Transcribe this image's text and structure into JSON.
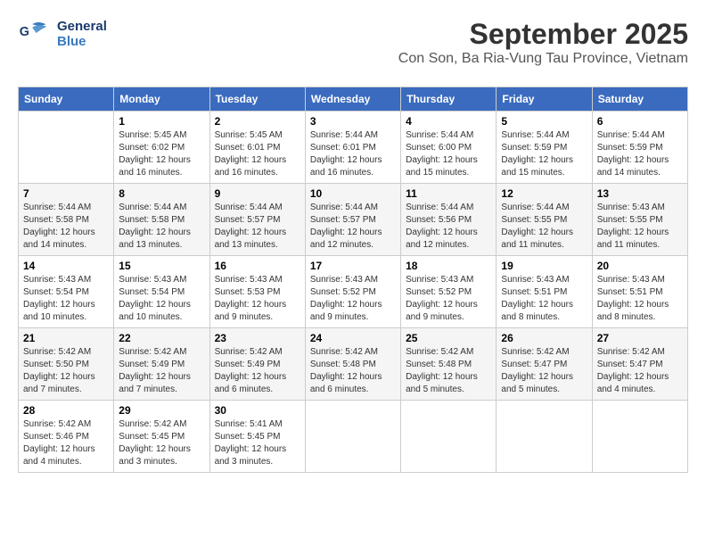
{
  "header": {
    "logo_line1": "General",
    "logo_line2": "Blue",
    "title": "September 2025",
    "subtitle": "Con Son, Ba Ria-Vung Tau Province, Vietnam"
  },
  "days_of_week": [
    "Sunday",
    "Monday",
    "Tuesday",
    "Wednesday",
    "Thursday",
    "Friday",
    "Saturday"
  ],
  "weeks": [
    [
      {
        "day": "",
        "content": ""
      },
      {
        "day": "1",
        "content": "Sunrise: 5:45 AM\nSunset: 6:02 PM\nDaylight: 12 hours\nand 16 minutes."
      },
      {
        "day": "2",
        "content": "Sunrise: 5:45 AM\nSunset: 6:01 PM\nDaylight: 12 hours\nand 16 minutes."
      },
      {
        "day": "3",
        "content": "Sunrise: 5:44 AM\nSunset: 6:01 PM\nDaylight: 12 hours\nand 16 minutes."
      },
      {
        "day": "4",
        "content": "Sunrise: 5:44 AM\nSunset: 6:00 PM\nDaylight: 12 hours\nand 15 minutes."
      },
      {
        "day": "5",
        "content": "Sunrise: 5:44 AM\nSunset: 5:59 PM\nDaylight: 12 hours\nand 15 minutes."
      },
      {
        "day": "6",
        "content": "Sunrise: 5:44 AM\nSunset: 5:59 PM\nDaylight: 12 hours\nand 14 minutes."
      }
    ],
    [
      {
        "day": "7",
        "content": "Sunrise: 5:44 AM\nSunset: 5:58 PM\nDaylight: 12 hours\nand 14 minutes."
      },
      {
        "day": "8",
        "content": "Sunrise: 5:44 AM\nSunset: 5:58 PM\nDaylight: 12 hours\nand 13 minutes."
      },
      {
        "day": "9",
        "content": "Sunrise: 5:44 AM\nSunset: 5:57 PM\nDaylight: 12 hours\nand 13 minutes."
      },
      {
        "day": "10",
        "content": "Sunrise: 5:44 AM\nSunset: 5:57 PM\nDaylight: 12 hours\nand 12 minutes."
      },
      {
        "day": "11",
        "content": "Sunrise: 5:44 AM\nSunset: 5:56 PM\nDaylight: 12 hours\nand 12 minutes."
      },
      {
        "day": "12",
        "content": "Sunrise: 5:44 AM\nSunset: 5:55 PM\nDaylight: 12 hours\nand 11 minutes."
      },
      {
        "day": "13",
        "content": "Sunrise: 5:43 AM\nSunset: 5:55 PM\nDaylight: 12 hours\nand 11 minutes."
      }
    ],
    [
      {
        "day": "14",
        "content": "Sunrise: 5:43 AM\nSunset: 5:54 PM\nDaylight: 12 hours\nand 10 minutes."
      },
      {
        "day": "15",
        "content": "Sunrise: 5:43 AM\nSunset: 5:54 PM\nDaylight: 12 hours\nand 10 minutes."
      },
      {
        "day": "16",
        "content": "Sunrise: 5:43 AM\nSunset: 5:53 PM\nDaylight: 12 hours\nand 9 minutes."
      },
      {
        "day": "17",
        "content": "Sunrise: 5:43 AM\nSunset: 5:52 PM\nDaylight: 12 hours\nand 9 minutes."
      },
      {
        "day": "18",
        "content": "Sunrise: 5:43 AM\nSunset: 5:52 PM\nDaylight: 12 hours\nand 9 minutes."
      },
      {
        "day": "19",
        "content": "Sunrise: 5:43 AM\nSunset: 5:51 PM\nDaylight: 12 hours\nand 8 minutes."
      },
      {
        "day": "20",
        "content": "Sunrise: 5:43 AM\nSunset: 5:51 PM\nDaylight: 12 hours\nand 8 minutes."
      }
    ],
    [
      {
        "day": "21",
        "content": "Sunrise: 5:42 AM\nSunset: 5:50 PM\nDaylight: 12 hours\nand 7 minutes."
      },
      {
        "day": "22",
        "content": "Sunrise: 5:42 AM\nSunset: 5:49 PM\nDaylight: 12 hours\nand 7 minutes."
      },
      {
        "day": "23",
        "content": "Sunrise: 5:42 AM\nSunset: 5:49 PM\nDaylight: 12 hours\nand 6 minutes."
      },
      {
        "day": "24",
        "content": "Sunrise: 5:42 AM\nSunset: 5:48 PM\nDaylight: 12 hours\nand 6 minutes."
      },
      {
        "day": "25",
        "content": "Sunrise: 5:42 AM\nSunset: 5:48 PM\nDaylight: 12 hours\nand 5 minutes."
      },
      {
        "day": "26",
        "content": "Sunrise: 5:42 AM\nSunset: 5:47 PM\nDaylight: 12 hours\nand 5 minutes."
      },
      {
        "day": "27",
        "content": "Sunrise: 5:42 AM\nSunset: 5:47 PM\nDaylight: 12 hours\nand 4 minutes."
      }
    ],
    [
      {
        "day": "28",
        "content": "Sunrise: 5:42 AM\nSunset: 5:46 PM\nDaylight: 12 hours\nand 4 minutes."
      },
      {
        "day": "29",
        "content": "Sunrise: 5:42 AM\nSunset: 5:45 PM\nDaylight: 12 hours\nand 3 minutes."
      },
      {
        "day": "30",
        "content": "Sunrise: 5:41 AM\nSunset: 5:45 PM\nDaylight: 12 hours\nand 3 minutes."
      },
      {
        "day": "",
        "content": ""
      },
      {
        "day": "",
        "content": ""
      },
      {
        "day": "",
        "content": ""
      },
      {
        "day": "",
        "content": ""
      }
    ]
  ]
}
